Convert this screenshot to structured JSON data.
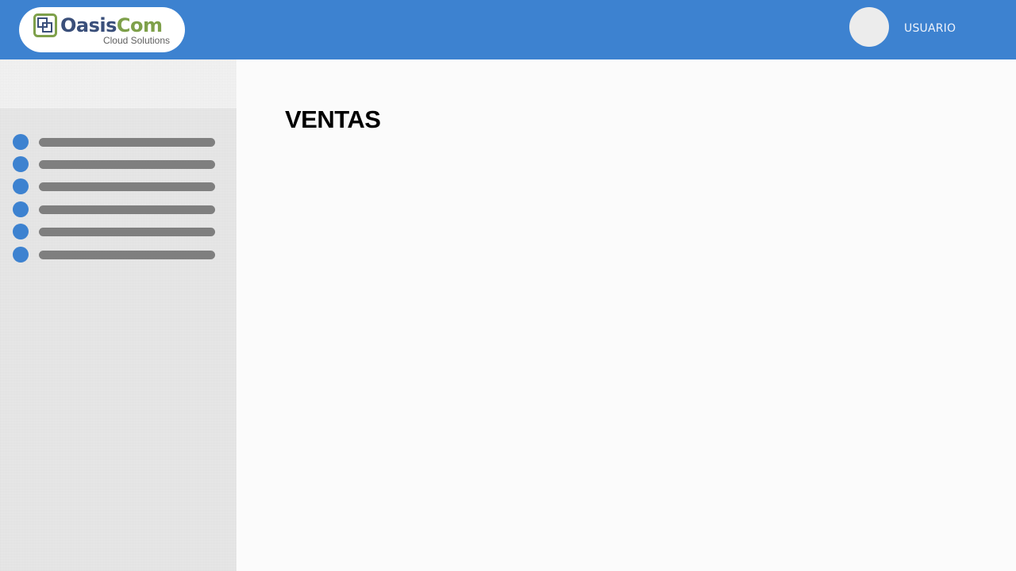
{
  "header": {
    "logo": {
      "brand_part1": "Oasis",
      "brand_part2": "Com",
      "tagline": "Cloud Solutions",
      "icon": "overlapping-squares-logo-icon"
    },
    "user": {
      "avatar_icon": "avatar-placeholder",
      "label": "USUARIO"
    }
  },
  "sidebar": {
    "items": [
      {
        "label": ""
      },
      {
        "label": ""
      },
      {
        "label": ""
      },
      {
        "label": ""
      },
      {
        "label": ""
      },
      {
        "label": ""
      }
    ]
  },
  "main": {
    "title": "VENTAS"
  },
  "colors": {
    "accent": "#3d82d0",
    "sidebar_bg": "#ececec",
    "placeholder_bar": "#7f7f7f",
    "brand_dark": "#3a4f7a",
    "brand_green": "#7ea04a"
  }
}
